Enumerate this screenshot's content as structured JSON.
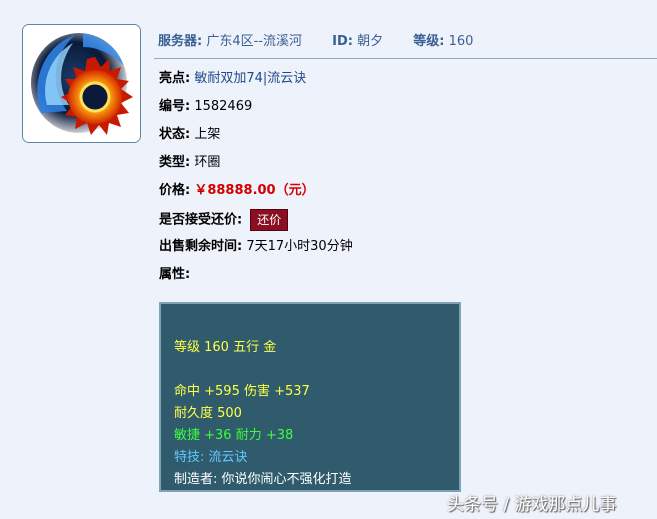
{
  "header": {
    "server_label": "服务器:",
    "server_value": "广东4区--流溪河",
    "id_label": "ID:",
    "id_value": "朝夕",
    "level_label": "等级:",
    "level_value": "160"
  },
  "details": {
    "highlight_label": "亮点:",
    "highlight_value": "敏耐双加74|流云诀",
    "number_label": "编号:",
    "number_value": "1582469",
    "status_label": "状态:",
    "status_value": "上架",
    "type_label": "类型:",
    "type_value": "环圈",
    "price_label": "价格:",
    "price_value": "￥88888.00（元）",
    "counteroffer_label": "是否接受还价:",
    "counteroffer_button": "还价",
    "remaining_label": "出售剩余时间:",
    "remaining_value": "7天17小时30分钟",
    "attributes_label": "属性:"
  },
  "tooltip": {
    "line_level": "等级 160 五行 金",
    "line_hit": "命中 +595 伤害 +537",
    "line_durability": "耐久度 500",
    "line_bonus": "敏捷 +36 耐力 +38",
    "line_skill": "特技: 流云诀",
    "line_maker": "制造者: 你说你闹心不强化打造"
  },
  "watermark": "头条号 / 游戏那点儿事",
  "icon": "ring-item-icon",
  "colors": {
    "header_text": "#3a5f95",
    "price": "#d40000",
    "button_bg": "#8a0f22",
    "tooltip_bg": "#2f5b6d",
    "tooltip_yellow": "#ffff48",
    "tooltip_green": "#3cff3c",
    "tooltip_blue": "#5fc8ff"
  }
}
